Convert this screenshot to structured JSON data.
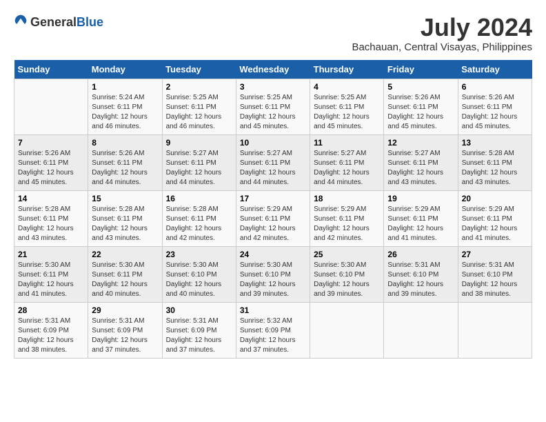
{
  "header": {
    "logo_general": "General",
    "logo_blue": "Blue",
    "month_year": "July 2024",
    "location": "Bachauan, Central Visayas, Philippines"
  },
  "weekdays": [
    "Sunday",
    "Monday",
    "Tuesday",
    "Wednesday",
    "Thursday",
    "Friday",
    "Saturday"
  ],
  "weeks": [
    [
      {
        "day": "",
        "sunrise": "",
        "sunset": "",
        "daylight": ""
      },
      {
        "day": "1",
        "sunrise": "Sunrise: 5:24 AM",
        "sunset": "Sunset: 6:11 PM",
        "daylight": "Daylight: 12 hours and 46 minutes."
      },
      {
        "day": "2",
        "sunrise": "Sunrise: 5:25 AM",
        "sunset": "Sunset: 6:11 PM",
        "daylight": "Daylight: 12 hours and 46 minutes."
      },
      {
        "day": "3",
        "sunrise": "Sunrise: 5:25 AM",
        "sunset": "Sunset: 6:11 PM",
        "daylight": "Daylight: 12 hours and 45 minutes."
      },
      {
        "day": "4",
        "sunrise": "Sunrise: 5:25 AM",
        "sunset": "Sunset: 6:11 PM",
        "daylight": "Daylight: 12 hours and 45 minutes."
      },
      {
        "day": "5",
        "sunrise": "Sunrise: 5:26 AM",
        "sunset": "Sunset: 6:11 PM",
        "daylight": "Daylight: 12 hours and 45 minutes."
      },
      {
        "day": "6",
        "sunrise": "Sunrise: 5:26 AM",
        "sunset": "Sunset: 6:11 PM",
        "daylight": "Daylight: 12 hours and 45 minutes."
      }
    ],
    [
      {
        "day": "7",
        "sunrise": "Sunrise: 5:26 AM",
        "sunset": "Sunset: 6:11 PM",
        "daylight": "Daylight: 12 hours and 45 minutes."
      },
      {
        "day": "8",
        "sunrise": "Sunrise: 5:26 AM",
        "sunset": "Sunset: 6:11 PM",
        "daylight": "Daylight: 12 hours and 44 minutes."
      },
      {
        "day": "9",
        "sunrise": "Sunrise: 5:27 AM",
        "sunset": "Sunset: 6:11 PM",
        "daylight": "Daylight: 12 hours and 44 minutes."
      },
      {
        "day": "10",
        "sunrise": "Sunrise: 5:27 AM",
        "sunset": "Sunset: 6:11 PM",
        "daylight": "Daylight: 12 hours and 44 minutes."
      },
      {
        "day": "11",
        "sunrise": "Sunrise: 5:27 AM",
        "sunset": "Sunset: 6:11 PM",
        "daylight": "Daylight: 12 hours and 44 minutes."
      },
      {
        "day": "12",
        "sunrise": "Sunrise: 5:27 AM",
        "sunset": "Sunset: 6:11 PM",
        "daylight": "Daylight: 12 hours and 43 minutes."
      },
      {
        "day": "13",
        "sunrise": "Sunrise: 5:28 AM",
        "sunset": "Sunset: 6:11 PM",
        "daylight": "Daylight: 12 hours and 43 minutes."
      }
    ],
    [
      {
        "day": "14",
        "sunrise": "Sunrise: 5:28 AM",
        "sunset": "Sunset: 6:11 PM",
        "daylight": "Daylight: 12 hours and 43 minutes."
      },
      {
        "day": "15",
        "sunrise": "Sunrise: 5:28 AM",
        "sunset": "Sunset: 6:11 PM",
        "daylight": "Daylight: 12 hours and 43 minutes."
      },
      {
        "day": "16",
        "sunrise": "Sunrise: 5:28 AM",
        "sunset": "Sunset: 6:11 PM",
        "daylight": "Daylight: 12 hours and 42 minutes."
      },
      {
        "day": "17",
        "sunrise": "Sunrise: 5:29 AM",
        "sunset": "Sunset: 6:11 PM",
        "daylight": "Daylight: 12 hours and 42 minutes."
      },
      {
        "day": "18",
        "sunrise": "Sunrise: 5:29 AM",
        "sunset": "Sunset: 6:11 PM",
        "daylight": "Daylight: 12 hours and 42 minutes."
      },
      {
        "day": "19",
        "sunrise": "Sunrise: 5:29 AM",
        "sunset": "Sunset: 6:11 PM",
        "daylight": "Daylight: 12 hours and 41 minutes."
      },
      {
        "day": "20",
        "sunrise": "Sunrise: 5:29 AM",
        "sunset": "Sunset: 6:11 PM",
        "daylight": "Daylight: 12 hours and 41 minutes."
      }
    ],
    [
      {
        "day": "21",
        "sunrise": "Sunrise: 5:30 AM",
        "sunset": "Sunset: 6:11 PM",
        "daylight": "Daylight: 12 hours and 41 minutes."
      },
      {
        "day": "22",
        "sunrise": "Sunrise: 5:30 AM",
        "sunset": "Sunset: 6:11 PM",
        "daylight": "Daylight: 12 hours and 40 minutes."
      },
      {
        "day": "23",
        "sunrise": "Sunrise: 5:30 AM",
        "sunset": "Sunset: 6:10 PM",
        "daylight": "Daylight: 12 hours and 40 minutes."
      },
      {
        "day": "24",
        "sunrise": "Sunrise: 5:30 AM",
        "sunset": "Sunset: 6:10 PM",
        "daylight": "Daylight: 12 hours and 39 minutes."
      },
      {
        "day": "25",
        "sunrise": "Sunrise: 5:30 AM",
        "sunset": "Sunset: 6:10 PM",
        "daylight": "Daylight: 12 hours and 39 minutes."
      },
      {
        "day": "26",
        "sunrise": "Sunrise: 5:31 AM",
        "sunset": "Sunset: 6:10 PM",
        "daylight": "Daylight: 12 hours and 39 minutes."
      },
      {
        "day": "27",
        "sunrise": "Sunrise: 5:31 AM",
        "sunset": "Sunset: 6:10 PM",
        "daylight": "Daylight: 12 hours and 38 minutes."
      }
    ],
    [
      {
        "day": "28",
        "sunrise": "Sunrise: 5:31 AM",
        "sunset": "Sunset: 6:09 PM",
        "daylight": "Daylight: 12 hours and 38 minutes."
      },
      {
        "day": "29",
        "sunrise": "Sunrise: 5:31 AM",
        "sunset": "Sunset: 6:09 PM",
        "daylight": "Daylight: 12 hours and 37 minutes."
      },
      {
        "day": "30",
        "sunrise": "Sunrise: 5:31 AM",
        "sunset": "Sunset: 6:09 PM",
        "daylight": "Daylight: 12 hours and 37 minutes."
      },
      {
        "day": "31",
        "sunrise": "Sunrise: 5:32 AM",
        "sunset": "Sunset: 6:09 PM",
        "daylight": "Daylight: 12 hours and 37 minutes."
      },
      {
        "day": "",
        "sunrise": "",
        "sunset": "",
        "daylight": ""
      },
      {
        "day": "",
        "sunrise": "",
        "sunset": "",
        "daylight": ""
      },
      {
        "day": "",
        "sunrise": "",
        "sunset": "",
        "daylight": ""
      }
    ]
  ]
}
